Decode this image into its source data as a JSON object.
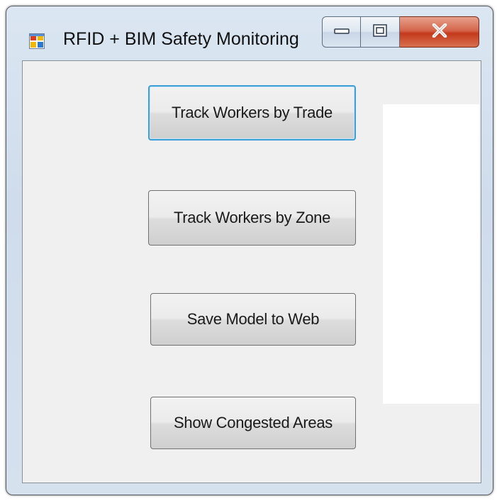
{
  "window": {
    "title": "RFID + BIM Safety Monitoring",
    "app_icon": "windows-form-icon",
    "caption_buttons": {
      "minimize_icon": "minimize-icon",
      "maximize_icon": "maximize-icon",
      "close_icon": "close-icon"
    }
  },
  "buttons": [
    {
      "label": "Track Workers by Trade",
      "focused": true
    },
    {
      "label": "Track Workers by Zone",
      "focused": false
    },
    {
      "label": "Save Model to Web",
      "focused": false
    },
    {
      "label": "Show Congested Areas",
      "focused": false
    }
  ],
  "colors": {
    "focus_border": "#3c9fd8",
    "close_button": "#c33a1c",
    "client_background": "#f0f0f0"
  }
}
